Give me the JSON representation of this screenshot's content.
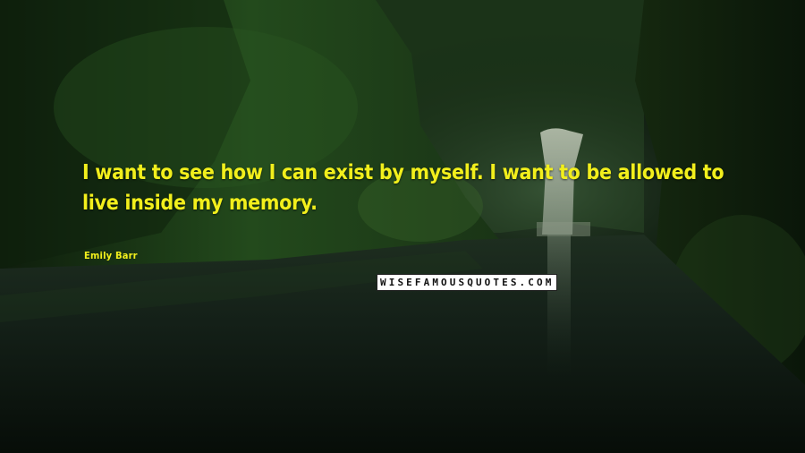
{
  "quote": {
    "text": "I want to see how I can exist by myself. I want to be allowed to live inside my memory.",
    "author": "Emily Barr"
  },
  "watermark": {
    "text": "WISEFAMOUSQUOTES.COM"
  },
  "colors": {
    "quote_text": "#f2ef1c",
    "foliage": "#1c3a18",
    "water": "#0c160e"
  },
  "scene": {
    "description_icon": "waterfall-forest-river-background"
  }
}
